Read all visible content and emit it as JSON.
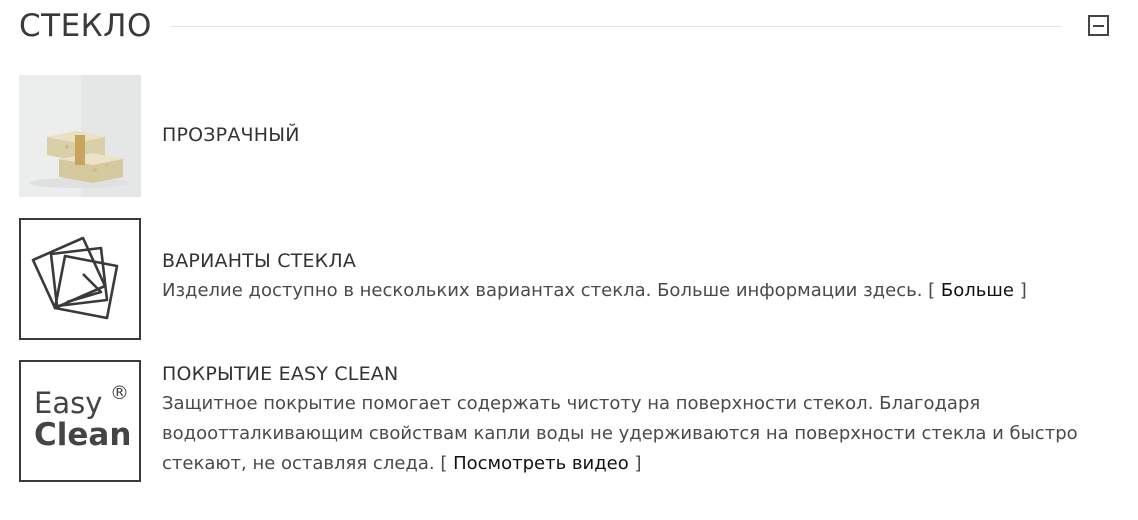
{
  "section": {
    "title": "СТЕКЛО",
    "collapse_icon": "minus-square-icon"
  },
  "options": [
    {
      "title": "ПРОЗРАЧНЫЙ",
      "image": "glass-soap-photo"
    },
    {
      "title": "ВАРИАНТЫ СТЕКЛА",
      "icon": "glass-variants-icon",
      "description": "Изделие доступно в нескольких вариантах стекла. Больше информации здесь.",
      "bracket_open": "[",
      "link_label": "Больше",
      "bracket_close": "]"
    },
    {
      "title": "ПОКРЫТИЕ EASY CLEAN",
      "icon": "easy-clean-logo-icon",
      "logo_line1": "Easy",
      "logo_line2": "Clean",
      "logo_mark": "®",
      "description": "Защитное покрытие помогает содержать чистоту на поверхности стекол. Благодаря водоотталкивающим свойствам капли воды не удерживаются на поверхности стекла и быстро стекают, не оставляя следа.",
      "bracket_open": "[",
      "link_label": "Посмотреть видео",
      "bracket_close": "]"
    }
  ]
}
